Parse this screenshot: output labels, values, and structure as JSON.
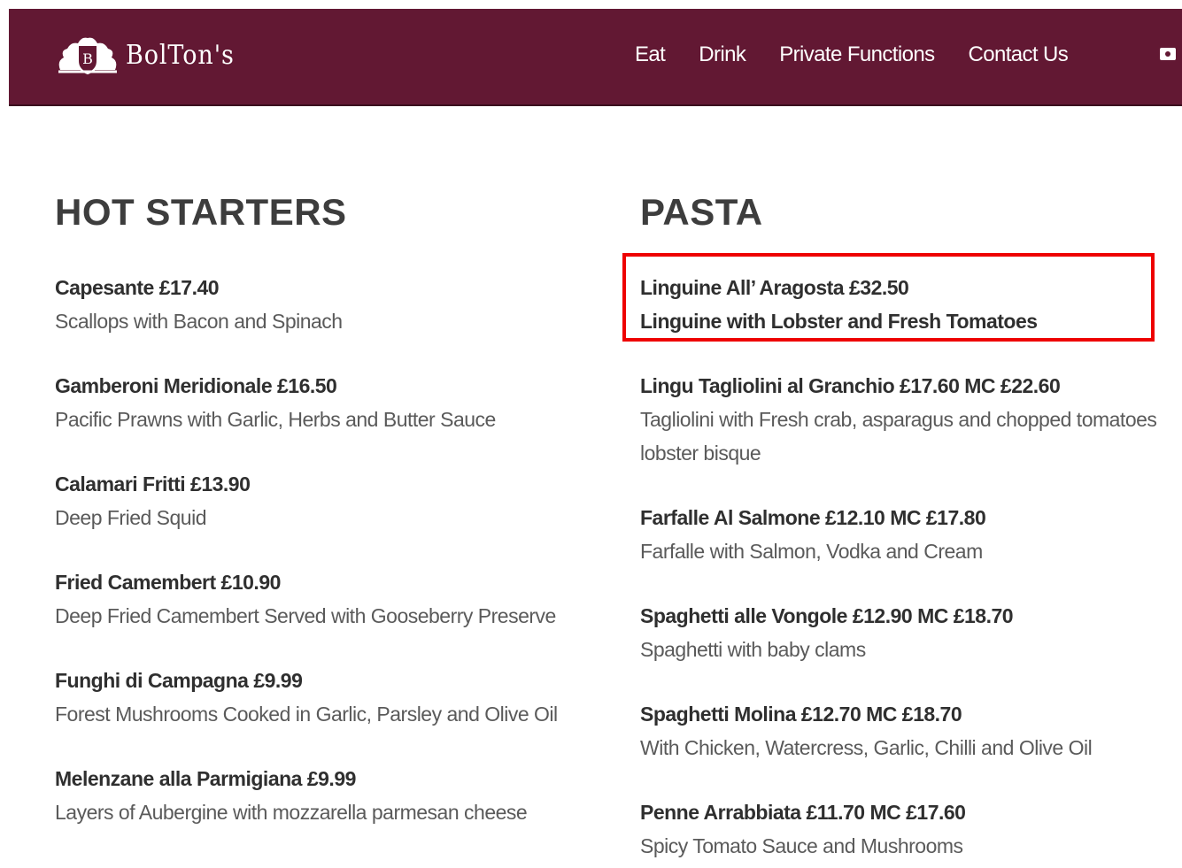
{
  "brand": {
    "name": "BolTon's"
  },
  "nav": {
    "items": [
      "Eat",
      "Drink",
      "Private Functions",
      "Contact Us"
    ]
  },
  "menu": {
    "hot_starters": {
      "title": "HOT STARTERS",
      "items": [
        {
          "name": "Capesante £17.40",
          "desc": "Scallops with Bacon and Spinach"
        },
        {
          "name": "Gamberoni Meridionale £16.50",
          "desc": "Pacific Prawns with Garlic, Herbs and Butter Sauce"
        },
        {
          "name": "Calamari Fritti £13.90",
          "desc": "Deep Fried Squid"
        },
        {
          "name": "Fried Camembert £10.90",
          "desc": "Deep Fried Camembert Served with Gooseberry Preserve"
        },
        {
          "name": "Funghi di Campagna £9.99",
          "desc": "Forest Mushrooms Cooked in Garlic, Parsley and Olive Oil"
        },
        {
          "name": "Melenzane alla Parmigiana £9.99",
          "desc": "Layers of Aubergine with mozzarella parmesan cheese"
        }
      ]
    },
    "pasta": {
      "title": "PASTA",
      "items": [
        {
          "name": "Linguine All’ Aragosta £32.50",
          "desc": "Linguine with Lobster and Fresh Tomatoes"
        },
        {
          "name": "Lingu Tagliolini al Granchio £17.60 MC £22.60",
          "desc": "Tagliolini with Fresh crab, asparagus and chopped tomatoes lobster bisque"
        },
        {
          "name": "Farfalle Al Salmone £12.10 MC £17.80",
          "desc": "Farfalle with Salmon, Vodka and Cream"
        },
        {
          "name": "Spaghetti alle Vongole £12.90 MC £18.70",
          "desc": "Spaghetti with baby clams"
        },
        {
          "name": "Spaghetti Molina £12.70 MC £18.70",
          "desc": "With Chicken, Watercress, Garlic, Chilli and Olive Oil"
        },
        {
          "name": "Penne Arrabbiata £11.70 MC £17.60",
          "desc": "Spicy Tomato Sauce and Mushrooms"
        }
      ]
    }
  },
  "icons": {
    "logo": "crest-logo-icon",
    "header_extra": "ticket-icon"
  },
  "colors": {
    "header_bg": "#621833",
    "highlight": "#ee0000",
    "title_text": "#3d3d3d",
    "desc_text": "#5a5a5a"
  }
}
